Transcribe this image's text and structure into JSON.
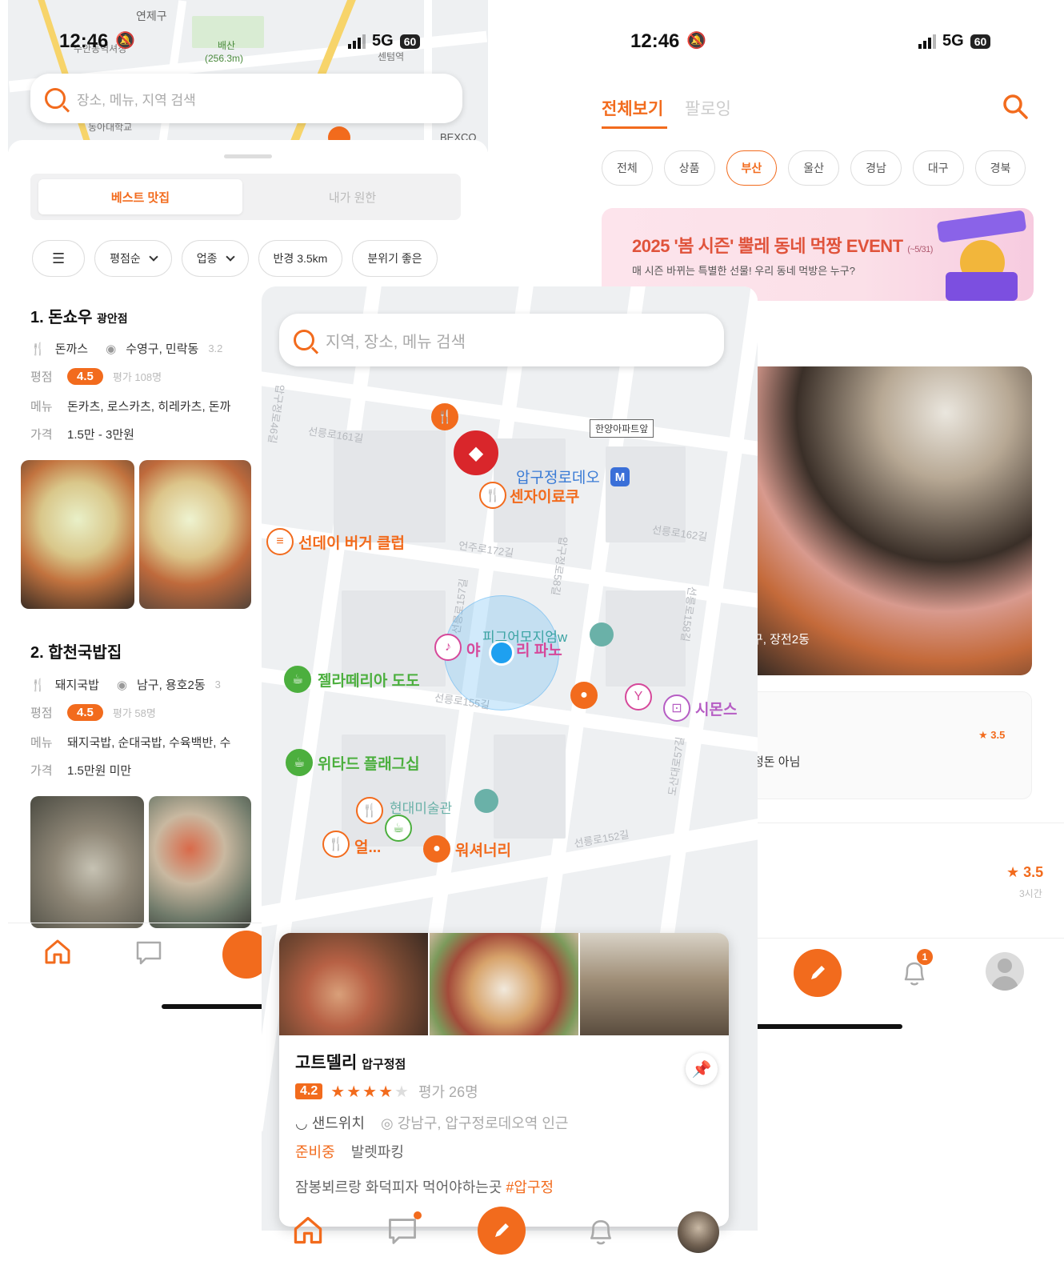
{
  "left": {
    "status": {
      "time": "12:46",
      "network": "5G",
      "battery": "60"
    },
    "map_labels": {
      "district": "연제구",
      "mountain": "배산",
      "mountain_height": "(256.3m)",
      "station": "센텀역",
      "place1": "수안동역셔청",
      "place2": "동아대학교",
      "place3": "BEXCO"
    },
    "search_placeholder": "장소, 메뉴, 지역 검색",
    "segments": {
      "active": "베스트 맛집",
      "inactive": "내가 원한"
    },
    "filters": {
      "sort": "평점순",
      "category": "업종",
      "radius": "반경 3.5km",
      "mood": "분위기 좋은"
    },
    "restaurants": [
      {
        "rank_name": "1. 돈쇼우",
        "branch": "광안점",
        "category": "돈까스",
        "location": "수영구, 민락동",
        "distance": "3.2",
        "rating_label": "평점",
        "rating": "4.5",
        "rating_count": "평가 108명",
        "menu_label": "메뉴",
        "menu": "돈카츠, 로스카츠, 히레카츠, 돈까",
        "price_label": "가격",
        "price": "1.5만 - 3만원"
      },
      {
        "rank_name": "2. 합천국밥집",
        "branch": "",
        "category": "돼지국밥",
        "location": "남구, 용호2동",
        "distance": "3",
        "rating_label": "평점",
        "rating": "4.5",
        "rating_count": "평가 58명",
        "menu_label": "메뉴",
        "menu": "돼지국밥, 순대국밥, 수육백반, 수",
        "price_label": "가격",
        "price": "1.5만원 미만"
      }
    ]
  },
  "center": {
    "search_placeholder": "지역, 장소, 메뉴 검색",
    "map_places": {
      "station": "압구정로데오",
      "p1": "센자이료쿠",
      "p2": "선데이 버거 클럽",
      "p3": "젤라떼리아 도도",
      "p4": "위타드 플래그십",
      "p5": "워셔너리",
      "p6": "시몬스",
      "p7": "얼...",
      "p8": "야",
      "p9": "리 파노",
      "p10": "피그어모지엄w",
      "p11": "현대미술관",
      "apt": "한양아파트앞",
      "s1": "선릉로161길",
      "s2": "압구정로46길",
      "s3": "선릉로162길",
      "s4": "언주로172길",
      "s5": "선릉로155길",
      "s6": "선릉로152길",
      "s7": "도산대로57길",
      "s8": "선릉로158길",
      "s9": "압구정로58길",
      "s10": "선릉로157길"
    },
    "card": {
      "name": "고트델리",
      "branch": "압구정점",
      "rating": "4.2",
      "stars": 4,
      "rating_count": "평가 26명",
      "category": "샌드위치",
      "location": "강남구, 압구정로데오역 인근",
      "status": "준비중",
      "parking": "발렛파킹",
      "desc": "잠봉뵈르랑 화덕피자 먹어야하는곳",
      "hashtag": "#압구정"
    }
  },
  "right": {
    "status": {
      "time": "12:46",
      "network": "5G",
      "battery": "60"
    },
    "tabs": {
      "all": "전체보기",
      "following": "팔로잉"
    },
    "regions": [
      "전체",
      "상품",
      "부산",
      "울산",
      "경남",
      "대구",
      "경북"
    ],
    "selected_region": "부산",
    "banner": {
      "title": "2025 '봄 시즌' 뿔레 동네 먹짱 EVENT",
      "period": "(~5/31)",
      "subtitle": "매 시즌 바뀌는 특별한 선물! 우리 동네 먹방은 누구?"
    },
    "post1_location": "구, 장전2동",
    "post1_rating": "3.5",
    "post1_text": "정돈 아님",
    "post2_rating": "3.5",
    "post2_time": "3시간",
    "notification_count": "1"
  },
  "colors": {
    "accent": "#f26b1d",
    "map_bg": "#eef0f2",
    "green_pin": "#4caf3e",
    "pink_pin": "#d6489a",
    "red_pin": "#d9262b"
  },
  "icons": [
    "search-icon",
    "home-icon",
    "chat-icon",
    "pencil-icon",
    "bell-icon",
    "profile-icon",
    "filter-icon",
    "location-pin-icon",
    "fork-knife-icon",
    "pushpin-icon",
    "star-icon"
  ]
}
